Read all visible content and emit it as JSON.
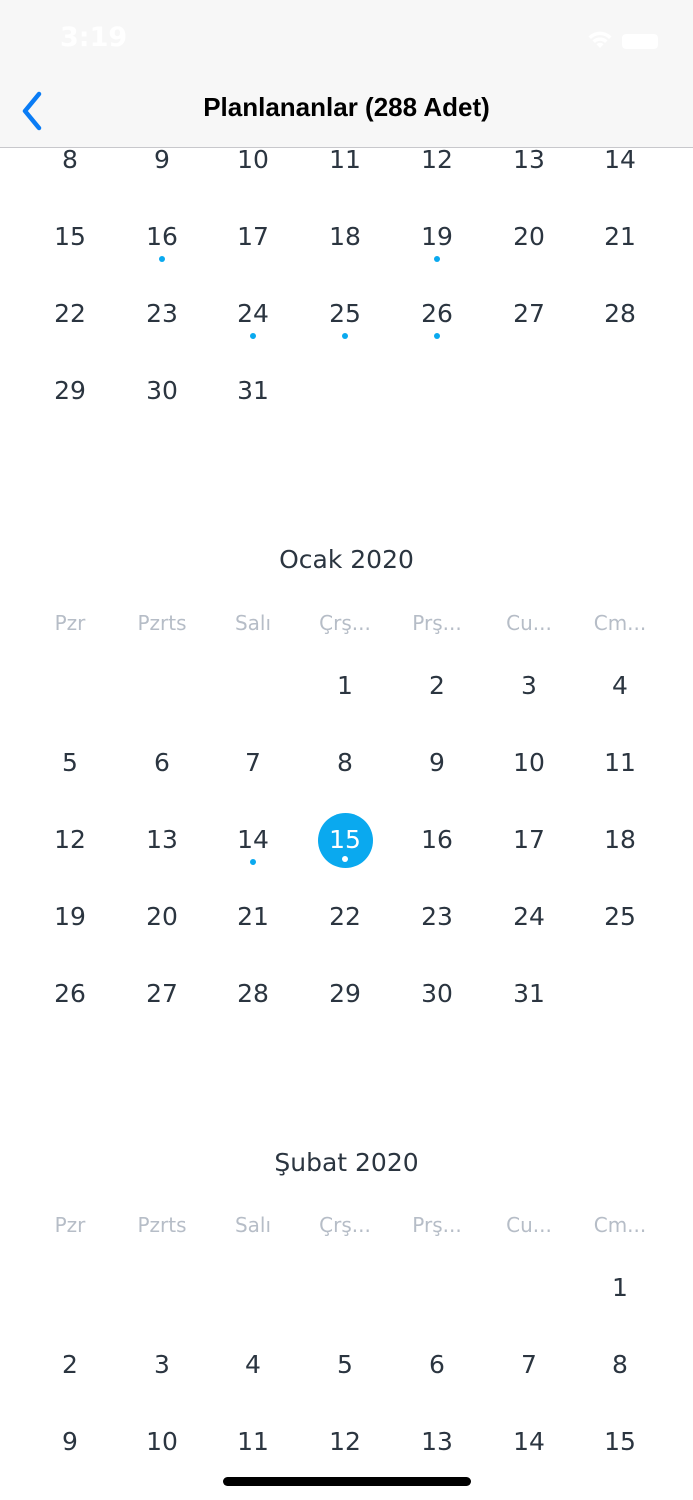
{
  "status_bar": {
    "time": "3:19"
  },
  "nav": {
    "back_icon": "chevron-left-icon",
    "title": "Planlananlar (288 Adet)"
  },
  "accent_color": "#0aa9ef",
  "weekdays": [
    "Pzr",
    "Pzrts",
    "Salı",
    "Çrş...",
    "Prş...",
    "Cu...",
    "Cm..."
  ],
  "partial_month": {
    "weeks": [
      [
        {
          "day": "8"
        },
        {
          "day": "9"
        },
        {
          "day": "10"
        },
        {
          "day": "11"
        },
        {
          "day": "12"
        },
        {
          "day": "13"
        },
        {
          "day": "14"
        }
      ],
      [
        {
          "day": "15"
        },
        {
          "day": "16",
          "dot": true
        },
        {
          "day": "17"
        },
        {
          "day": "18"
        },
        {
          "day": "19",
          "dot": true
        },
        {
          "day": "20"
        },
        {
          "day": "21"
        }
      ],
      [
        {
          "day": "22"
        },
        {
          "day": "23"
        },
        {
          "day": "24",
          "dot": true
        },
        {
          "day": "25",
          "dot": true
        },
        {
          "day": "26",
          "dot": true
        },
        {
          "day": "27"
        },
        {
          "day": "28"
        }
      ],
      [
        {
          "day": "29"
        },
        {
          "day": "30"
        },
        {
          "day": "31"
        },
        null,
        null,
        null,
        null
      ]
    ]
  },
  "months": [
    {
      "title": "Ocak 2020",
      "weeks": [
        [
          null,
          null,
          null,
          {
            "day": "1"
          },
          {
            "day": "2"
          },
          {
            "day": "3"
          },
          {
            "day": "4"
          }
        ],
        [
          {
            "day": "5"
          },
          {
            "day": "6"
          },
          {
            "day": "7"
          },
          {
            "day": "8"
          },
          {
            "day": "9"
          },
          {
            "day": "10"
          },
          {
            "day": "11"
          }
        ],
        [
          {
            "day": "12"
          },
          {
            "day": "13"
          },
          {
            "day": "14",
            "dot": true
          },
          {
            "day": "15",
            "dot": true,
            "selected": true
          },
          {
            "day": "16"
          },
          {
            "day": "17"
          },
          {
            "day": "18"
          }
        ],
        [
          {
            "day": "19"
          },
          {
            "day": "20"
          },
          {
            "day": "21"
          },
          {
            "day": "22"
          },
          {
            "day": "23"
          },
          {
            "day": "24"
          },
          {
            "day": "25"
          }
        ],
        [
          {
            "day": "26"
          },
          {
            "day": "27"
          },
          {
            "day": "28"
          },
          {
            "day": "29"
          },
          {
            "day": "30"
          },
          {
            "day": "31"
          },
          null
        ]
      ]
    },
    {
      "title": "Şubat 2020",
      "weeks": [
        [
          null,
          null,
          null,
          null,
          null,
          null,
          {
            "day": "1"
          }
        ],
        [
          {
            "day": "2"
          },
          {
            "day": "3"
          },
          {
            "day": "4"
          },
          {
            "day": "5"
          },
          {
            "day": "6"
          },
          {
            "day": "7"
          },
          {
            "day": "8"
          }
        ],
        [
          {
            "day": "9"
          },
          {
            "day": "10"
          },
          {
            "day": "11"
          },
          {
            "day": "12"
          },
          {
            "day": "13"
          },
          {
            "day": "14"
          },
          {
            "day": "15"
          }
        ]
      ]
    }
  ]
}
